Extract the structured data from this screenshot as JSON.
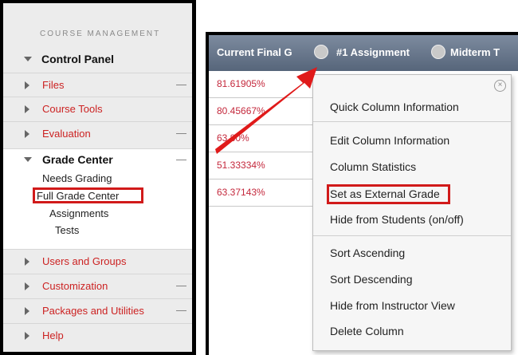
{
  "sidebar": {
    "header": "COURSE MANAGEMENT",
    "control_panel": "Control Panel",
    "items_top": [
      {
        "label": "Files",
        "dash": "—"
      },
      {
        "label": "Course Tools",
        "dash": ""
      },
      {
        "label": "Evaluation",
        "dash": "—"
      }
    ],
    "grade_center": {
      "title": "Grade Center",
      "dash": "—",
      "links": [
        "Needs Grading",
        "Full Grade Center",
        "Assignments",
        "Tests"
      ]
    },
    "items_bottom": [
      {
        "label": "Users and Groups",
        "dash": ""
      },
      {
        "label": "Customization",
        "dash": "—"
      },
      {
        "label": "Packages and Utilities",
        "dash": "—"
      },
      {
        "label": "Help",
        "dash": ""
      }
    ]
  },
  "grade_center_table": {
    "columns": [
      "Current Final G",
      "#1 Assignment",
      "Midterm T"
    ],
    "values": [
      "81.61905%",
      "80.45667%",
      "63.80%",
      "51.33334%",
      "63.37143%"
    ]
  },
  "context_menu": {
    "close": "×",
    "groups": [
      [
        "Quick Column Information"
      ],
      [
        "Edit Column Information",
        "Column Statistics",
        "Set as External Grade",
        "Hide from Students (on/off)"
      ],
      [
        "Sort Ascending",
        "Sort Descending",
        "Hide from Instructor View",
        "Delete Column"
      ]
    ]
  },
  "colors": {
    "highlight": "#d11a1a",
    "link_red": "#cc2222",
    "header_bg": "#56657a"
  }
}
